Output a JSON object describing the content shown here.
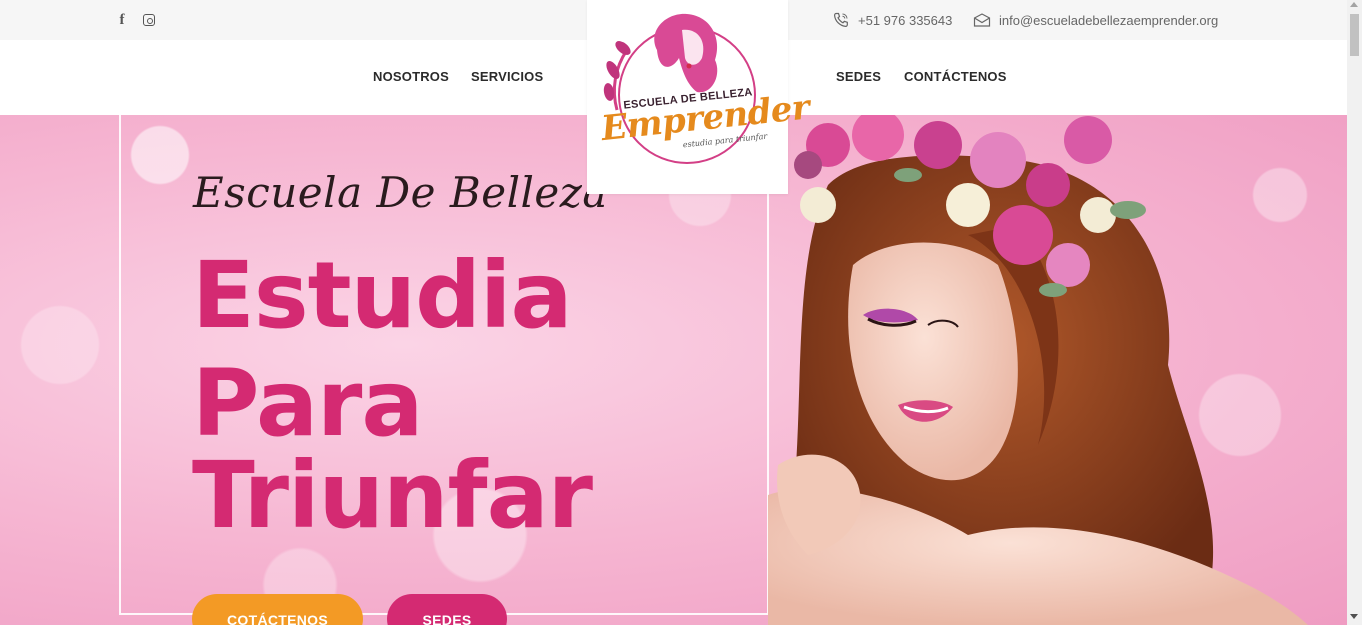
{
  "topbar": {
    "social": [
      {
        "icon": "facebook-icon",
        "glyph": "f"
      },
      {
        "icon": "instagram-icon"
      }
    ],
    "phone": "+51 976 335643",
    "email": "info@escueladebellezaemprender.org"
  },
  "nav": {
    "items": [
      "NOSOTROS",
      "SERVICIOS",
      "SEDES",
      "CONTÁCTENOS"
    ]
  },
  "logo": {
    "top_text": "ESCUELA DE BELLEZA",
    "main_text": "Emprender",
    "tagline": "estudia para triunfar"
  },
  "hero": {
    "script_title": "Escuela De Belleza",
    "headline": [
      "Estudia",
      "Para",
      "Triunfar"
    ],
    "buttons": {
      "contact": "COTÁCTENOS",
      "sedes": "SEDES"
    }
  },
  "colors": {
    "accent_pink": "#d42a72",
    "accent_orange": "#f39a25",
    "hero_bg": "#f6b6d2"
  }
}
